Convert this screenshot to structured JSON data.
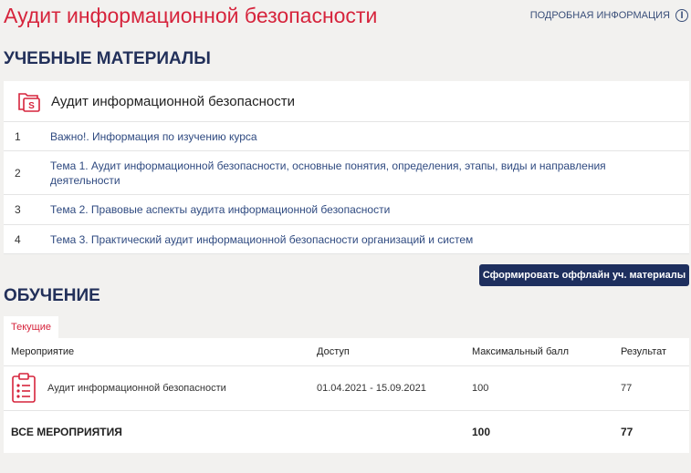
{
  "header": {
    "title": "Аудит информационной безопасности",
    "details_label": "ПОДРОБНАЯ ИНФОРМАЦИЯ",
    "info_glyph": "i"
  },
  "materials": {
    "section_title": "УЧЕБНЫЕ МАТЕРИАЛЫ",
    "course_title": "Аудит информационной безопасности",
    "items": [
      {
        "num": "1",
        "title": "Важно!. Информация по изучению курса"
      },
      {
        "num": "2",
        "title": "Тема 1. Аудит информационной безопасности, основные понятия, определения, этапы, виды и направления деятельности"
      },
      {
        "num": "3",
        "title": "Тема 2. Правовые аспекты аудита информационной безопасности"
      },
      {
        "num": "4",
        "title": "Тема 3. Практический аудит информационной безопасности организаций и систем"
      }
    ],
    "offline_button_label": "Сформировать оффлайн уч. материалы"
  },
  "training": {
    "section_title": "ОБУЧЕНИЕ",
    "tab_current": "Текущие",
    "columns": [
      "Мероприятие",
      "Доступ",
      "Максимальный балл",
      "Результат"
    ],
    "rows": [
      {
        "name": "Аудит информационной безопасности",
        "access": "01.04.2021 - 15.09.2021",
        "max_score": "100",
        "result": "77"
      }
    ],
    "total": {
      "label": "ВСЕ МЕРОПРИЯТИЯ",
      "max_score": "100",
      "result": "77"
    }
  },
  "colors": {
    "accent": "#d6243c",
    "navy": "#22305a",
    "link": "#2f4a80"
  }
}
